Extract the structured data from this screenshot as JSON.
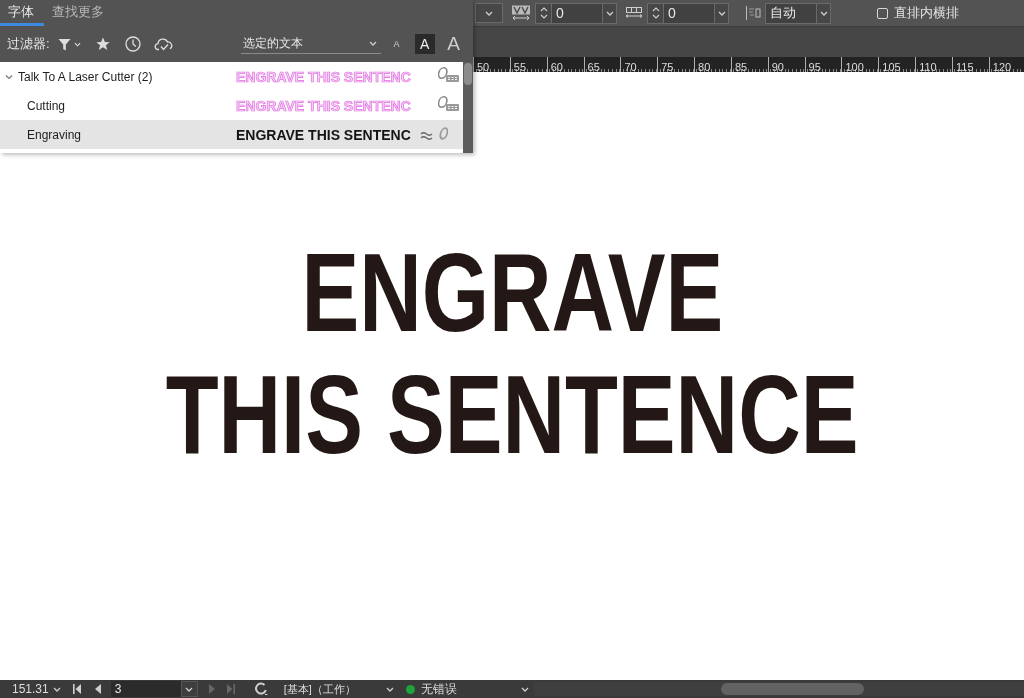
{
  "font_panel": {
    "tabs": [
      {
        "label": "字体",
        "selected": true
      },
      {
        "label": "查找更多",
        "selected": false
      }
    ],
    "filter_label": "过滤器:",
    "preview_source": {
      "value": "选定的文本"
    },
    "preview_sizes": [
      {
        "label": "A",
        "kind": "small",
        "selected": false
      },
      {
        "label": "A",
        "kind": "medium",
        "selected": true
      },
      {
        "label": "A",
        "kind": "large",
        "selected": false
      }
    ],
    "fonts": [
      {
        "name": "Talk To A Laser Cutter (2)",
        "expanded": true,
        "selected": false,
        "preview": "ENGRAVE THIS SENTENC",
        "kind": "svg",
        "children": [
          {
            "name": "Cutting",
            "selected": false,
            "preview": "ENGRAVE THIS SENTENC",
            "kind": "svg"
          },
          {
            "name": "Engraving",
            "selected": true,
            "preview": "ENGRAVE THIS SENTENC",
            "kind": "opentype"
          }
        ]
      }
    ]
  },
  "toolbar": {
    "kerning": {
      "value": "0"
    },
    "tracking": {
      "value": "0"
    },
    "alignment": {
      "value": "自动"
    },
    "vertical_in_horizontal": {
      "label": "直排内横排",
      "checked": false
    }
  },
  "ruler": {
    "labels": [
      "50",
      "55",
      "60",
      "65",
      "70",
      "75",
      "80",
      "85",
      "90",
      "95",
      "100",
      "105",
      "110",
      "115",
      "120"
    ]
  },
  "canvas": {
    "lines": [
      "ENGRAVE",
      "THIS SENTENCE"
    ]
  },
  "status_bar": {
    "zoom": "151.31",
    "page_navigation": {
      "first": {
        "disabled": false
      },
      "previous": {
        "disabled": false
      },
      "page": "3",
      "next": {
        "disabled": true
      },
      "last": {
        "disabled": true
      }
    },
    "preflight": {
      "profile": "[基本]（工作）",
      "ok": true,
      "status": "无错误"
    }
  }
}
